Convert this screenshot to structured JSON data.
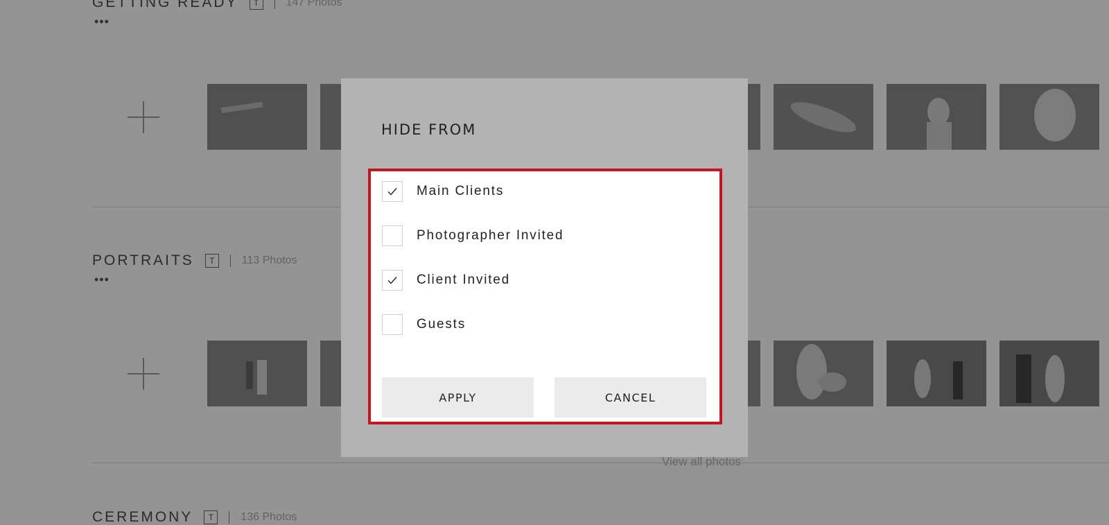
{
  "background": {
    "sections": [
      {
        "title": "GETTING READY",
        "t_label": "T",
        "count": "147 Photos"
      },
      {
        "title": "PORTRAITS",
        "t_label": "T",
        "count": "113 Photos"
      },
      {
        "title": "CEREMONY",
        "t_label": "T",
        "count": "136 Photos"
      }
    ],
    "view_all": "View all photos"
  },
  "dialog": {
    "title": "HIDE FROM",
    "options": [
      {
        "label": "Main Clients",
        "checked": true
      },
      {
        "label": "Photographer Invited",
        "checked": false
      },
      {
        "label": "Client Invited",
        "checked": true
      },
      {
        "label": "Guests",
        "checked": false
      }
    ],
    "apply_label": "APPLY",
    "cancel_label": "CANCEL"
  },
  "colors": {
    "highlight_border": "#c8141c",
    "modal_bg": "#b3b3b3",
    "button_bg": "#ebebeb"
  }
}
